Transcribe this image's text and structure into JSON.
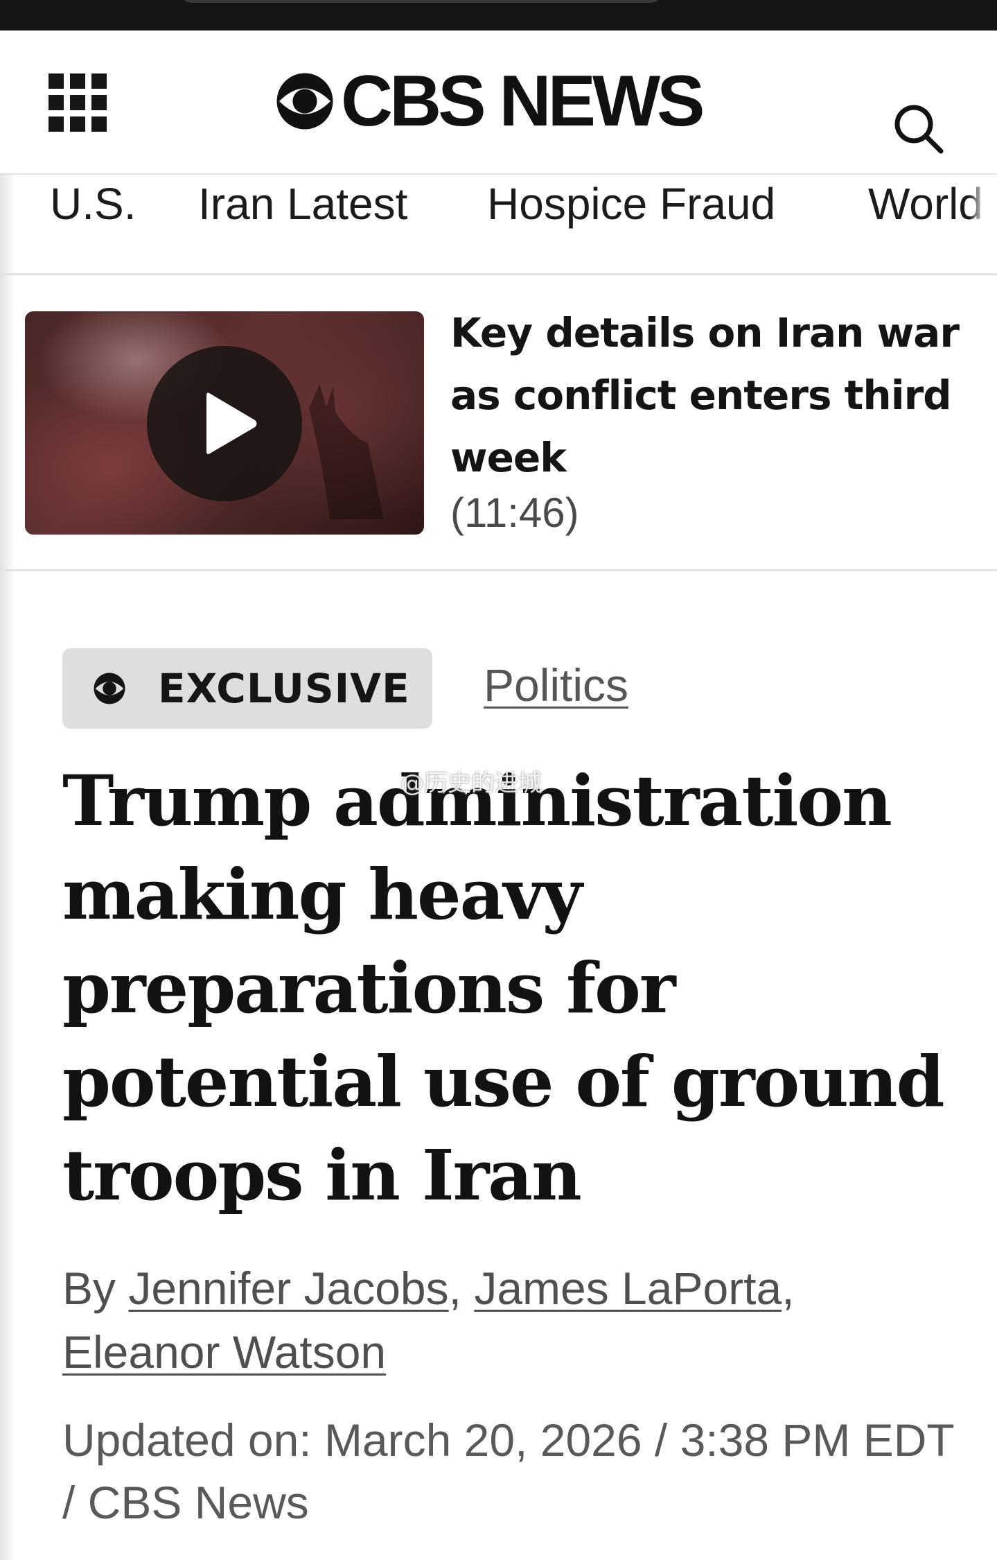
{
  "header": {
    "logo_text": "CBS NEWS",
    "menu_icon": "grid-menu-icon",
    "search_icon": "search-icon"
  },
  "nav": {
    "items": [
      {
        "label": "U.S."
      },
      {
        "label": "Iran Latest"
      },
      {
        "label": "Hospice Fraud"
      },
      {
        "label": "World"
      }
    ]
  },
  "promo": {
    "title": "Key details on Iran war as conflict enters third week",
    "duration": "(11:46)",
    "play_icon": "play-icon"
  },
  "article": {
    "badge_label": "EXCLUSIVE",
    "section": "Politics",
    "headline": "Trump administration making heavy preparations for potential use of ground troops in Iran",
    "byline_prefix": "By",
    "authors": [
      "Jennifer Jacobs",
      "James LaPorta",
      "Eleanor Watson"
    ],
    "updated": "Updated on: March 20, 2026 / 3:38 PM EDT / CBS News"
  },
  "watermark": "@历史的进城",
  "colors": {
    "text": "#141414",
    "muted": "#555555",
    "badge_bg": "#dedede",
    "status_bar": "#151515"
  }
}
